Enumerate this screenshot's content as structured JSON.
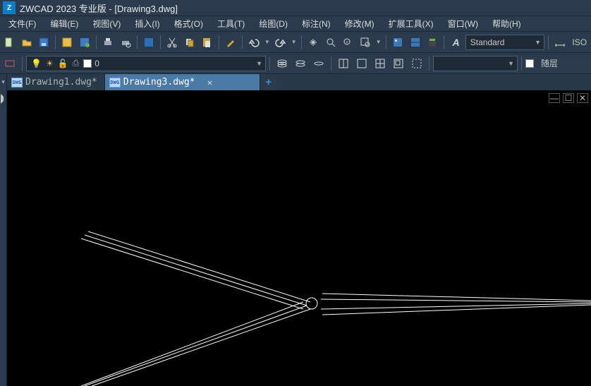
{
  "title": "ZWCAD 2023 专业版 - [Drawing3.dwg]",
  "menu": {
    "file": "文件(F)",
    "edit": "编辑(E)",
    "view": "视图(V)",
    "insert": "插入(I)",
    "format": "格式(O)",
    "tools": "工具(T)",
    "draw": "绘图(D)",
    "dim": "标注(N)",
    "modify": "修改(M)",
    "ext": "扩展工具(X)",
    "window": "窗口(W)",
    "help": "帮助(H)"
  },
  "toolbar1": {
    "style_value": "Standard",
    "iso_label": "ISO"
  },
  "toolbar2": {
    "layer_value": "0",
    "bylayer_label": "随层"
  },
  "tabs": {
    "t1": "Drawing1.dwg*",
    "t2": "Drawing3.dwg*"
  },
  "canvas": {
    "min": "—",
    "max": "☐",
    "close": "✕"
  }
}
